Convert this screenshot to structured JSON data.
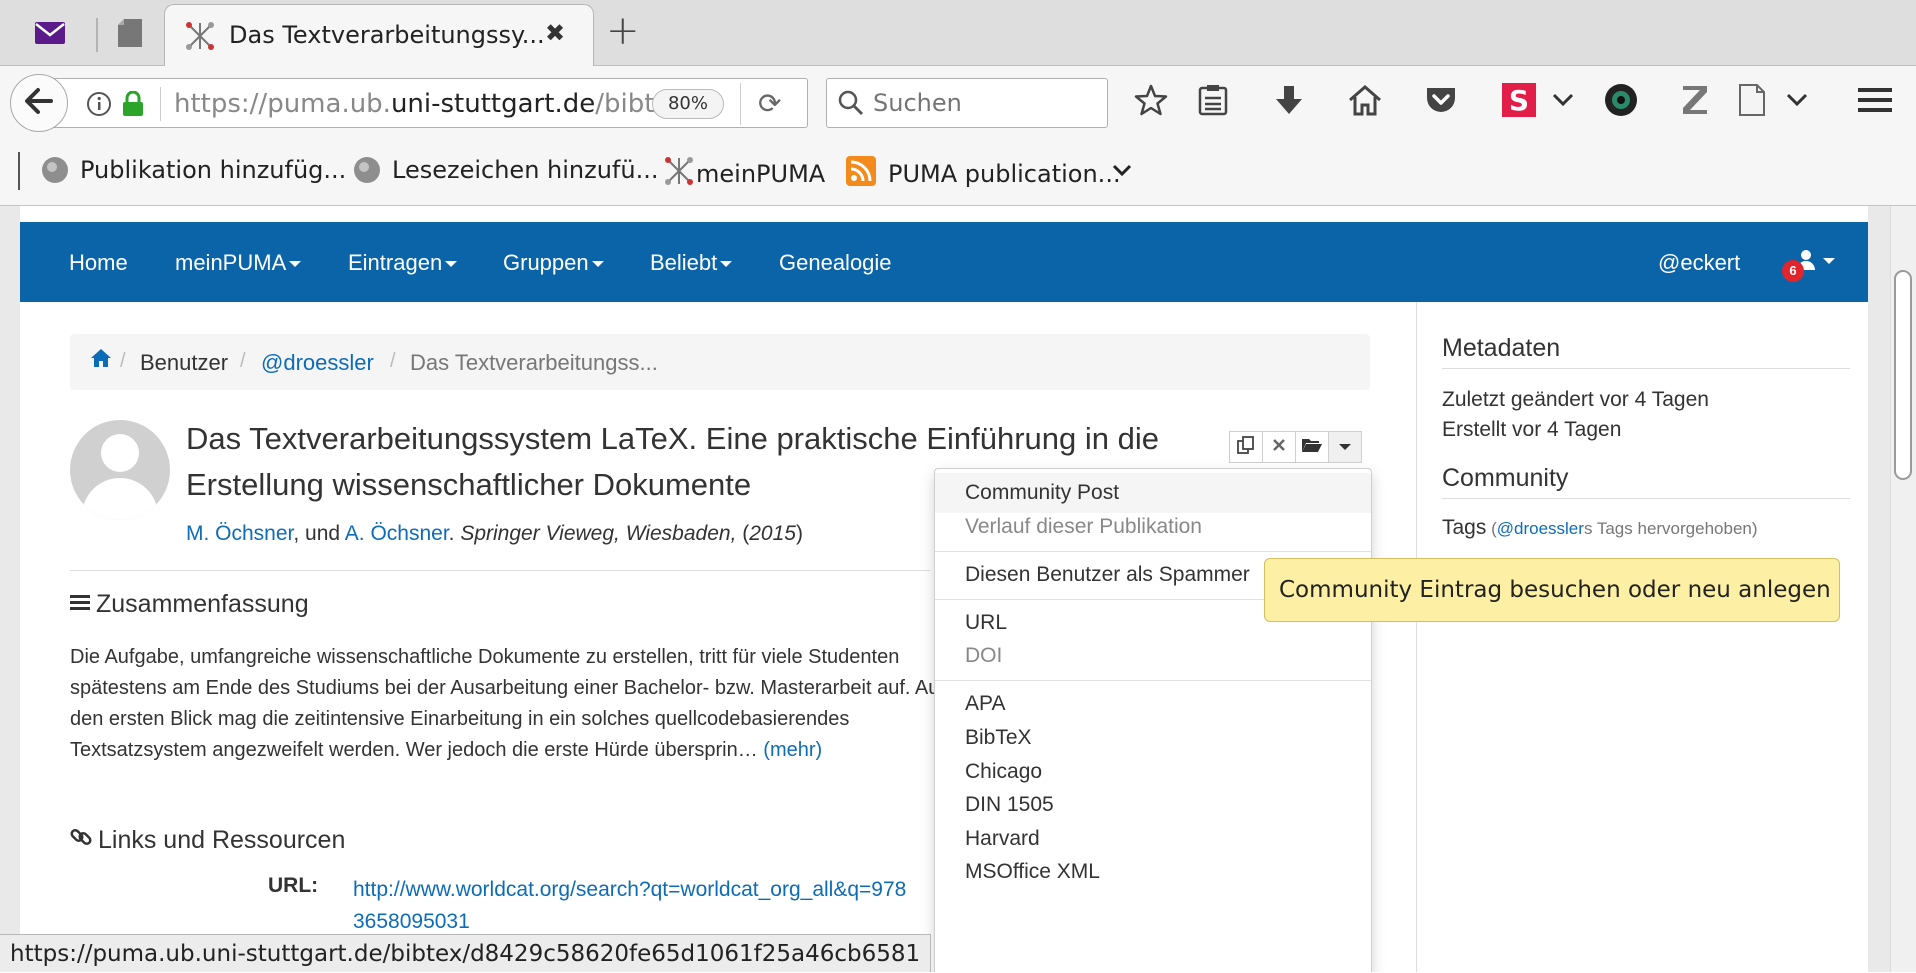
{
  "browser": {
    "tab_title": "Das Textverarbeitungssy...",
    "url_prefix": "https://puma.ub.",
    "url_domain": "uni-stuttgart.de",
    "url_suffix": "/bibte",
    "zoom": "80%",
    "search_placeholder": "Suchen",
    "bookmarks": [
      "Publikation hinzufüg...",
      "Lesezeichen hinzufü...",
      "meinPUMA",
      "PUMA publication..."
    ],
    "status_url": "https://puma.ub.uni-stuttgart.de/bibtex/d8429c58620fe65d1061f25a46cb6581"
  },
  "nav": {
    "home": "Home",
    "meinpuma": "meinPUMA",
    "eintragen": "Eintragen",
    "gruppen": "Gruppen",
    "beliebt": "Beliebt",
    "genealogie": "Genealogie",
    "user": "@eckert",
    "badge": "6"
  },
  "breadcrumb": {
    "benutzer": "Benutzer",
    "user": "@droessler",
    "current": "Das Textverarbeitungss..."
  },
  "post": {
    "title": "Das Textverarbeitungssystem LaTeX. Eine praktische Einführung in die Erstellung wissenschaftlicher Dokumente",
    "author1": "M. Öchsner",
    "and_text": ", und ",
    "author2": "A. Öchsner",
    "publisher": "Springer Vieweg, Wiesbaden,",
    "year_open": " (",
    "year": "2015",
    "year_close": ")",
    "abstract_title": "Zusammenfassung",
    "abstract": "Die Aufgabe, umfangreiche wissenschaftliche Dokumente zu erstellen, tritt für viele Studenten spätestens am Ende des Studiums bei der Ausarbeitung einer Bachelor- bzw. Masterarbeit auf. Auf den ersten Blick mag die zeitintensive Einarbeitung in ein solches quellcodebasierendes Textsatzsystem angezweifelt werden. Wer jedoch die erste Hürde übersprin…",
    "more": "(mehr)",
    "links_title": "Links und Ressourcen",
    "url_label": "URL:",
    "url_value": "http://www.worldcat.org/search?qt=worldcat_org_all&q=9783658095031"
  },
  "dropdown": {
    "community_post": "Community Post",
    "history": "Verlauf dieser Publikation",
    "spammer": "Diesen Benutzer als Spammer",
    "url": "URL",
    "doi": "DOI",
    "apa": "APA",
    "bibtex": "BibTeX",
    "chicago": "Chicago",
    "din": "DIN 1505",
    "harvard": "Harvard",
    "msoffice": "MSOffice XML"
  },
  "sidebar": {
    "metadata_title": "Metadaten",
    "changed": "Zuletzt geändert vor 4 Tagen",
    "created": "Erstellt vor 4 Tagen",
    "community_title": "Community",
    "tags": "Tags",
    "tags_paren_open": " (",
    "tags_user": "@droessler",
    "tags_rest": "s Tags hervorgehoben)"
  },
  "tooltip": "Community Eintrag besuchen oder neu anlegen",
  "colors": {
    "nav_bg": "#0b64a8",
    "link": "#0d6cb8",
    "tooltip_bg": "#fdf0a4",
    "badge": "#e0262c"
  }
}
